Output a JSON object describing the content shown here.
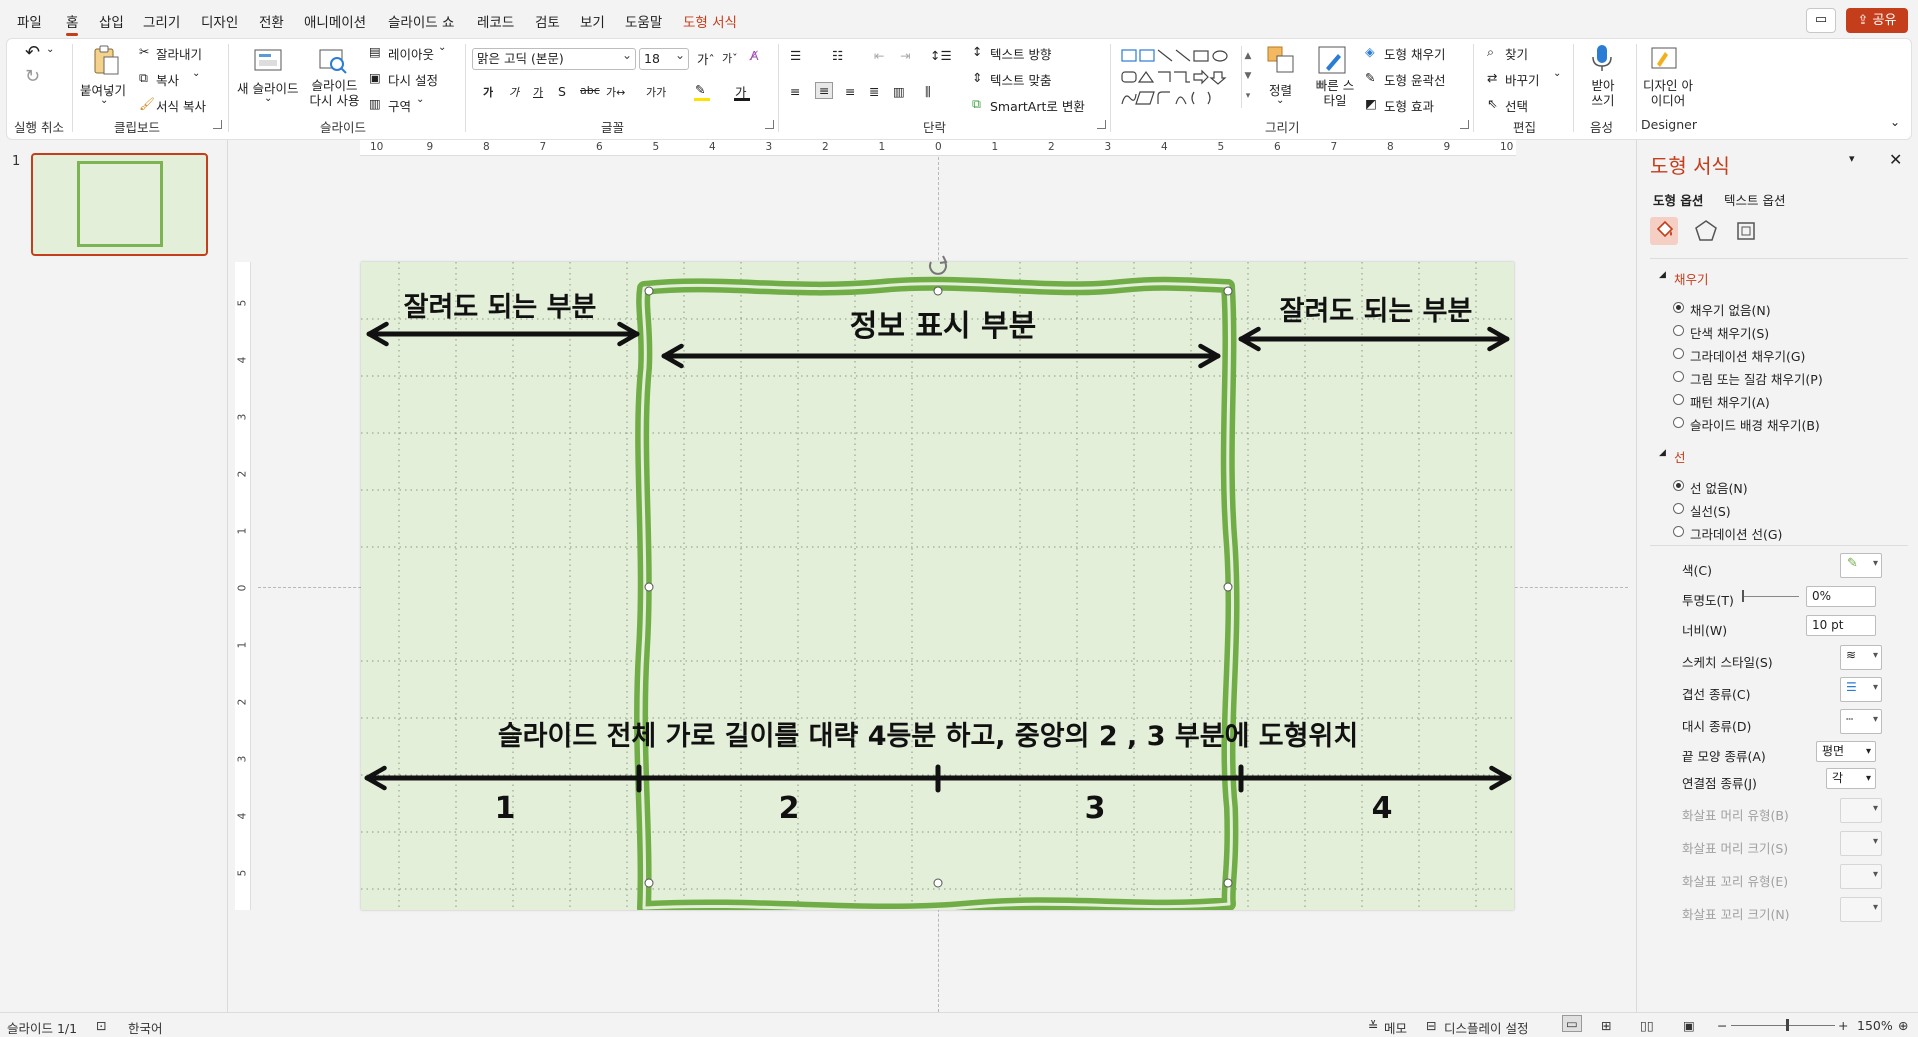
{
  "menu": {
    "items": [
      "파일",
      "홈",
      "삽입",
      "그리기",
      "디자인",
      "전환",
      "애니메이션",
      "슬라이드 쇼",
      "레코드",
      "검토",
      "보기",
      "도움말",
      "도형 서식"
    ],
    "share": "공유"
  },
  "ribbon": {
    "undo_group": "실행 취소",
    "clipboard": {
      "label": "클립보드",
      "paste": "붙여넣기",
      "cut": "잘라내기",
      "copy": "복사",
      "format_painter": "서식 복사"
    },
    "slides": {
      "label": "슬라이드",
      "new_slide": "새 슬라이드",
      "reuse": "슬라이드 다시 사용",
      "layout": "레이아웃",
      "reset": "다시 설정",
      "section": "구역"
    },
    "font": {
      "label": "글꼴",
      "name": "맑은 고딕 (본문)",
      "size": "18"
    },
    "paragraph": {
      "label": "단락",
      "text_direction": "텍스트 방향",
      "align_text": "텍스트 맞춤",
      "smartart": "SmartArt로 변환"
    },
    "drawing": {
      "label": "그리기",
      "arrange": "정렬",
      "quick_styles": "빠른 스타일",
      "shape_fill": "도형 채우기",
      "shape_outline": "도형 윤곽선",
      "shape_effects": "도형 효과"
    },
    "editing": {
      "label": "편집",
      "find": "찾기",
      "replace": "바꾸기",
      "select": "선택"
    },
    "voice": {
      "label": "음성",
      "dictate": "받아 쓰기"
    },
    "designer": {
      "label": "Designer",
      "design_ideas": "디자인 아이디어"
    }
  },
  "thumbnail": {
    "number": "1"
  },
  "ruler": {
    "h_ticks": [
      "10",
      "9",
      "8",
      "7",
      "6",
      "5",
      "4",
      "3",
      "2",
      "1",
      "0",
      "1",
      "2",
      "3",
      "4",
      "5",
      "6",
      "7",
      "8",
      "9",
      "10"
    ],
    "v_ticks": [
      "5",
      "4",
      "3",
      "2",
      "1",
      "0",
      "1",
      "2",
      "3",
      "4",
      "5"
    ]
  },
  "slide": {
    "left_label": "잘려도 되는 부분",
    "center_label": "정보 표시 부분",
    "right_label": "잘려도 되는 부분",
    "bottom_caption": "슬라이드 전체 가로 길이를 대략 4등분 하고, 중앙의 2 , 3 부분에 도형위치",
    "segments": [
      "1",
      "2",
      "3",
      "4"
    ],
    "bg_color": "#e3efd9",
    "frame_color": "#70ad47"
  },
  "format_pane": {
    "title": "도형 서식",
    "tabs": [
      "도형 옵션",
      "텍스트 옵션"
    ],
    "fill_section": "채우기",
    "fill_options": [
      "채우기 없음(N)",
      "단색 채우기(S)",
      "그라데이션 채우기(G)",
      "그림 또는 질감 채우기(P)",
      "패턴 채우기(A)",
      "슬라이드 배경 채우기(B)"
    ],
    "line_section": "선",
    "line_options": [
      "선 없음(N)",
      "실선(S)",
      "그라데이션 선(G)"
    ],
    "props": {
      "color": "색(C)",
      "transparency": "투명도(T)",
      "transparency_value": "0%",
      "width": "너비(W)",
      "width_value": "10 pt",
      "sketch_style": "스케치 스타일(S)",
      "compound_type": "겹선 종류(C)",
      "dash_type": "대시 종류(D)",
      "cap_type": "끝 모양 종류(A)",
      "cap_value": "평면",
      "join_type": "연결점 종류(J)",
      "join_value": "각",
      "begin_arrow_type": "화살표 머리 유형(B)",
      "begin_arrow_size": "화살표 머리 크기(S)",
      "end_arrow_type": "화살표 꼬리 유형(E)",
      "end_arrow_size": "화살표 꼬리 크기(N)"
    }
  },
  "status": {
    "slide_info": "슬라이드 1/1",
    "language": "한국어",
    "notes": "메모",
    "display_settings": "디스플레이 설정",
    "zoom": "150%"
  }
}
